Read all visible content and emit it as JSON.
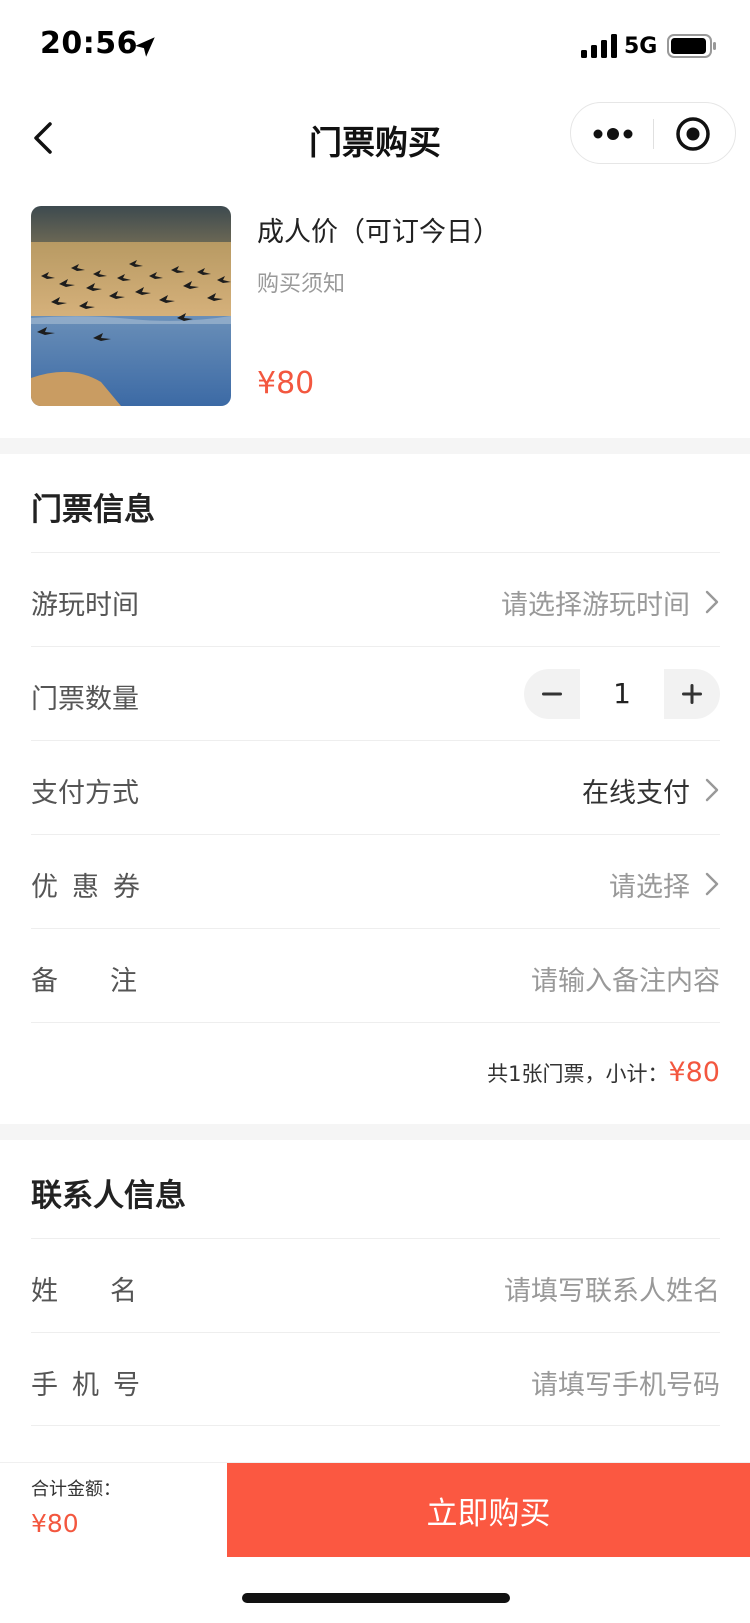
{
  "status_bar": {
    "time": "20:56",
    "network": "5G",
    "icons": [
      "location-arrow-icon",
      "signal-icon",
      "battery-icon"
    ]
  },
  "nav": {
    "title": "门票购买",
    "icons": [
      "back-icon",
      "more-icon",
      "close-mini-icon"
    ]
  },
  "product": {
    "title": "成人价（可订今日）",
    "notice": "购买须知",
    "price": "¥80"
  },
  "ticket_section": {
    "title": "门票信息",
    "rows": {
      "visit_time": {
        "label": "游玩时间",
        "placeholder": "请选择游玩时间"
      },
      "quantity": {
        "label": "门票数量",
        "value": "1"
      },
      "payment": {
        "label": "支付方式",
        "value": "在线支付"
      },
      "coupon": {
        "label": "优惠券",
        "placeholder": "请选择"
      },
      "remark": {
        "label": "备注",
        "placeholder": "请输入备注内容"
      }
    },
    "summary": {
      "text": "共1张门票，小计：",
      "amount": "¥80"
    }
  },
  "contact_section": {
    "title": "联系人信息",
    "rows": {
      "name": {
        "label": "姓名",
        "placeholder": "请填写联系人姓名"
      },
      "phone": {
        "label": "手机号",
        "placeholder": "请填写手机号码"
      }
    }
  },
  "footer": {
    "total_label": "合计金额：",
    "total_amount": "¥80",
    "buy_label": "立即购买"
  },
  "colors": {
    "accent": "#f3573f",
    "button": "#fb5841",
    "separator": "#f5f5f5"
  }
}
